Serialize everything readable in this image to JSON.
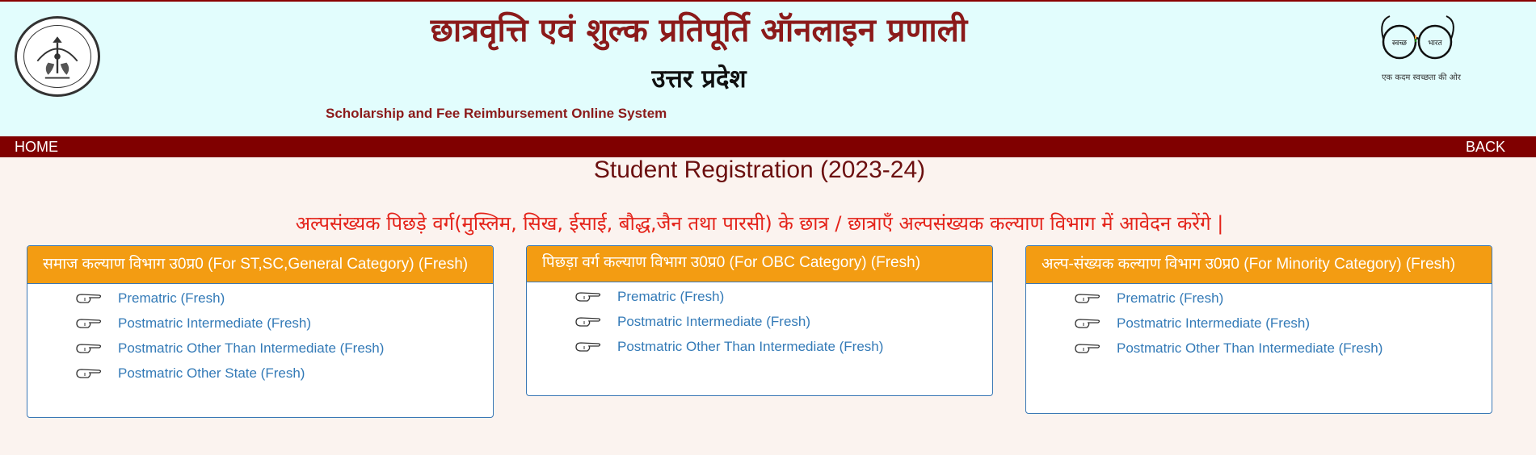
{
  "header": {
    "title_hindi": "छात्रवृत्ति एवं शुल्क प्रतिपूर्ति ऑनलाइन प्रणाली",
    "state_hindi": "उत्तर प्रदेश",
    "title_english": "Scholarship and Fee Reimbursement Online System",
    "emblem_icon": "up-government-emblem-icon",
    "swachh_icon": "swachh-bharat-spectacles-icon",
    "swachh_word_left": "स्वच्छ",
    "swachh_word_right": "भारत",
    "swachh_tagline": "एक कदम स्वच्छता की ओर"
  },
  "nav": {
    "home_label": "HOME",
    "back_label": "BACK"
  },
  "page": {
    "title": "Student Registration (2023-24)",
    "notice": "अल्पसंख्यक पिछड़े वर्ग(मुस्लिम, सिख, ईसाई, बौद्ध,जैन तथा पारसी) के छात्र / छात्राएँ अल्पसंख्यक कल्याण विभाग में आवेदन करेंगे |"
  },
  "cards": [
    {
      "heading": "समाज कल्याण विभाग उ0प्र0 (For ST,SC,General Category) (Fresh)",
      "links": [
        "Prematric (Fresh)",
        "Postmatric Intermediate (Fresh)",
        "Postmatric Other Than Intermediate (Fresh)",
        "Postmatric Other State (Fresh)"
      ]
    },
    {
      "heading": "पिछड़ा वर्ग कल्याण विभाग उ0प्र0 (For OBC Category) (Fresh)",
      "links": [
        "Prematric (Fresh)",
        "Postmatric Intermediate (Fresh)",
        "Postmatric Other Than Intermediate (Fresh)"
      ]
    },
    {
      "heading": "अल्प-संख्यक कल्याण विभाग उ0प्र0 (For Minority Category) (Fresh)",
      "links": [
        "Prematric (Fresh)",
        "Postmatric Intermediate (Fresh)",
        "Postmatric Other Than Intermediate (Fresh)"
      ]
    }
  ],
  "icons": {
    "link_bullet": "pointing-hand-icon"
  },
  "colors": {
    "header_bg": "#e2fdfd",
    "nav_bg": "#800000",
    "title_maroon": "#8b1a1a",
    "notice_red": "#e4231a",
    "card_head_orange": "#f39c12",
    "link_blue": "#337ab7",
    "card_border": "#3a78b5"
  }
}
